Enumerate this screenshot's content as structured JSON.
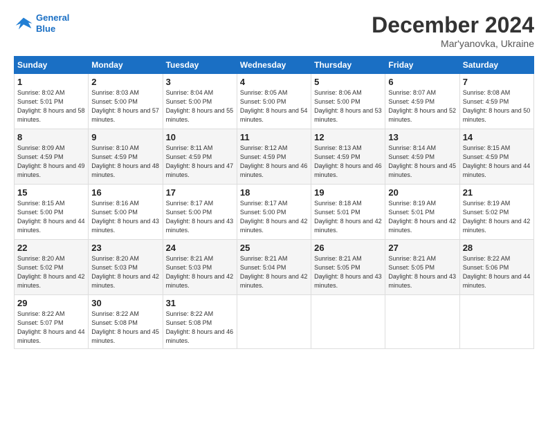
{
  "header": {
    "logo_line1": "General",
    "logo_line2": "Blue",
    "month_title": "December 2024",
    "location": "Mar'yanovka, Ukraine"
  },
  "days_of_week": [
    "Sunday",
    "Monday",
    "Tuesday",
    "Wednesday",
    "Thursday",
    "Friday",
    "Saturday"
  ],
  "weeks": [
    [
      {
        "day": "1",
        "sunrise": "8:02 AM",
        "sunset": "5:01 PM",
        "daylight": "8 hours and 58 minutes."
      },
      {
        "day": "2",
        "sunrise": "8:03 AM",
        "sunset": "5:00 PM",
        "daylight": "8 hours and 57 minutes."
      },
      {
        "day": "3",
        "sunrise": "8:04 AM",
        "sunset": "5:00 PM",
        "daylight": "8 hours and 55 minutes."
      },
      {
        "day": "4",
        "sunrise": "8:05 AM",
        "sunset": "5:00 PM",
        "daylight": "8 hours and 54 minutes."
      },
      {
        "day": "5",
        "sunrise": "8:06 AM",
        "sunset": "5:00 PM",
        "daylight": "8 hours and 53 minutes."
      },
      {
        "day": "6",
        "sunrise": "8:07 AM",
        "sunset": "4:59 PM",
        "daylight": "8 hours and 52 minutes."
      },
      {
        "day": "7",
        "sunrise": "8:08 AM",
        "sunset": "4:59 PM",
        "daylight": "8 hours and 50 minutes."
      }
    ],
    [
      {
        "day": "8",
        "sunrise": "8:09 AM",
        "sunset": "4:59 PM",
        "daylight": "8 hours and 49 minutes."
      },
      {
        "day": "9",
        "sunrise": "8:10 AM",
        "sunset": "4:59 PM",
        "daylight": "8 hours and 48 minutes."
      },
      {
        "day": "10",
        "sunrise": "8:11 AM",
        "sunset": "4:59 PM",
        "daylight": "8 hours and 47 minutes."
      },
      {
        "day": "11",
        "sunrise": "8:12 AM",
        "sunset": "4:59 PM",
        "daylight": "8 hours and 46 minutes."
      },
      {
        "day": "12",
        "sunrise": "8:13 AM",
        "sunset": "4:59 PM",
        "daylight": "8 hours and 46 minutes."
      },
      {
        "day": "13",
        "sunrise": "8:14 AM",
        "sunset": "4:59 PM",
        "daylight": "8 hours and 45 minutes."
      },
      {
        "day": "14",
        "sunrise": "8:15 AM",
        "sunset": "4:59 PM",
        "daylight": "8 hours and 44 minutes."
      }
    ],
    [
      {
        "day": "15",
        "sunrise": "8:15 AM",
        "sunset": "5:00 PM",
        "daylight": "8 hours and 44 minutes."
      },
      {
        "day": "16",
        "sunrise": "8:16 AM",
        "sunset": "5:00 PM",
        "daylight": "8 hours and 43 minutes."
      },
      {
        "day": "17",
        "sunrise": "8:17 AM",
        "sunset": "5:00 PM",
        "daylight": "8 hours and 43 minutes."
      },
      {
        "day": "18",
        "sunrise": "8:17 AM",
        "sunset": "5:00 PM",
        "daylight": "8 hours and 42 minutes."
      },
      {
        "day": "19",
        "sunrise": "8:18 AM",
        "sunset": "5:01 PM",
        "daylight": "8 hours and 42 minutes."
      },
      {
        "day": "20",
        "sunrise": "8:19 AM",
        "sunset": "5:01 PM",
        "daylight": "8 hours and 42 minutes."
      },
      {
        "day": "21",
        "sunrise": "8:19 AM",
        "sunset": "5:02 PM",
        "daylight": "8 hours and 42 minutes."
      }
    ],
    [
      {
        "day": "22",
        "sunrise": "8:20 AM",
        "sunset": "5:02 PM",
        "daylight": "8 hours and 42 minutes."
      },
      {
        "day": "23",
        "sunrise": "8:20 AM",
        "sunset": "5:03 PM",
        "daylight": "8 hours and 42 minutes."
      },
      {
        "day": "24",
        "sunrise": "8:21 AM",
        "sunset": "5:03 PM",
        "daylight": "8 hours and 42 minutes."
      },
      {
        "day": "25",
        "sunrise": "8:21 AM",
        "sunset": "5:04 PM",
        "daylight": "8 hours and 42 minutes."
      },
      {
        "day": "26",
        "sunrise": "8:21 AM",
        "sunset": "5:05 PM",
        "daylight": "8 hours and 43 minutes."
      },
      {
        "day": "27",
        "sunrise": "8:21 AM",
        "sunset": "5:05 PM",
        "daylight": "8 hours and 43 minutes."
      },
      {
        "day": "28",
        "sunrise": "8:22 AM",
        "sunset": "5:06 PM",
        "daylight": "8 hours and 44 minutes."
      }
    ],
    [
      {
        "day": "29",
        "sunrise": "8:22 AM",
        "sunset": "5:07 PM",
        "daylight": "8 hours and 44 minutes."
      },
      {
        "day": "30",
        "sunrise": "8:22 AM",
        "sunset": "5:08 PM",
        "daylight": "8 hours and 45 minutes."
      },
      {
        "day": "31",
        "sunrise": "8:22 AM",
        "sunset": "5:08 PM",
        "daylight": "8 hours and 46 minutes."
      },
      null,
      null,
      null,
      null
    ]
  ],
  "labels": {
    "sunrise": "Sunrise:",
    "sunset": "Sunset:",
    "daylight": "Daylight:"
  }
}
